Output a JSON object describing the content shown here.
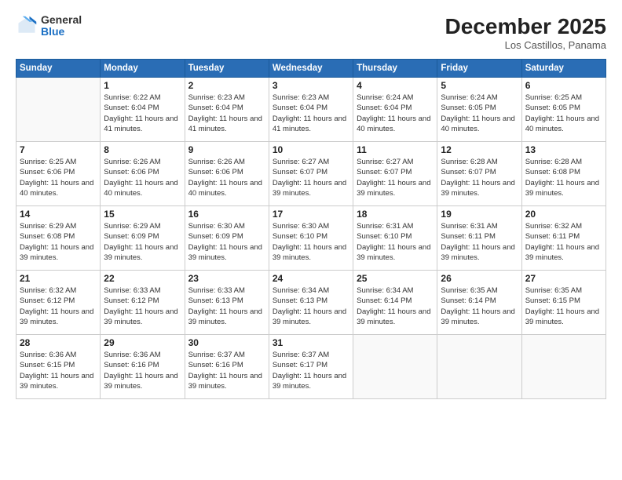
{
  "header": {
    "logo": {
      "general": "General",
      "blue": "Blue"
    },
    "title": "December 2025",
    "location": "Los Castillos, Panama"
  },
  "days_of_week": [
    "Sunday",
    "Monday",
    "Tuesday",
    "Wednesday",
    "Thursday",
    "Friday",
    "Saturday"
  ],
  "weeks": [
    [
      {
        "day": "",
        "sunrise": "",
        "sunset": "",
        "daylight": ""
      },
      {
        "day": "1",
        "sunrise": "Sunrise: 6:22 AM",
        "sunset": "Sunset: 6:04 PM",
        "daylight": "Daylight: 11 hours and 41 minutes."
      },
      {
        "day": "2",
        "sunrise": "Sunrise: 6:23 AM",
        "sunset": "Sunset: 6:04 PM",
        "daylight": "Daylight: 11 hours and 41 minutes."
      },
      {
        "day": "3",
        "sunrise": "Sunrise: 6:23 AM",
        "sunset": "Sunset: 6:04 PM",
        "daylight": "Daylight: 11 hours and 41 minutes."
      },
      {
        "day": "4",
        "sunrise": "Sunrise: 6:24 AM",
        "sunset": "Sunset: 6:04 PM",
        "daylight": "Daylight: 11 hours and 40 minutes."
      },
      {
        "day": "5",
        "sunrise": "Sunrise: 6:24 AM",
        "sunset": "Sunset: 6:05 PM",
        "daylight": "Daylight: 11 hours and 40 minutes."
      },
      {
        "day": "6",
        "sunrise": "Sunrise: 6:25 AM",
        "sunset": "Sunset: 6:05 PM",
        "daylight": "Daylight: 11 hours and 40 minutes."
      }
    ],
    [
      {
        "day": "7",
        "sunrise": "Sunrise: 6:25 AM",
        "sunset": "Sunset: 6:06 PM",
        "daylight": "Daylight: 11 hours and 40 minutes."
      },
      {
        "day": "8",
        "sunrise": "Sunrise: 6:26 AM",
        "sunset": "Sunset: 6:06 PM",
        "daylight": "Daylight: 11 hours and 40 minutes."
      },
      {
        "day": "9",
        "sunrise": "Sunrise: 6:26 AM",
        "sunset": "Sunset: 6:06 PM",
        "daylight": "Daylight: 11 hours and 40 minutes."
      },
      {
        "day": "10",
        "sunrise": "Sunrise: 6:27 AM",
        "sunset": "Sunset: 6:07 PM",
        "daylight": "Daylight: 11 hours and 39 minutes."
      },
      {
        "day": "11",
        "sunrise": "Sunrise: 6:27 AM",
        "sunset": "Sunset: 6:07 PM",
        "daylight": "Daylight: 11 hours and 39 minutes."
      },
      {
        "day": "12",
        "sunrise": "Sunrise: 6:28 AM",
        "sunset": "Sunset: 6:07 PM",
        "daylight": "Daylight: 11 hours and 39 minutes."
      },
      {
        "day": "13",
        "sunrise": "Sunrise: 6:28 AM",
        "sunset": "Sunset: 6:08 PM",
        "daylight": "Daylight: 11 hours and 39 minutes."
      }
    ],
    [
      {
        "day": "14",
        "sunrise": "Sunrise: 6:29 AM",
        "sunset": "Sunset: 6:08 PM",
        "daylight": "Daylight: 11 hours and 39 minutes."
      },
      {
        "day": "15",
        "sunrise": "Sunrise: 6:29 AM",
        "sunset": "Sunset: 6:09 PM",
        "daylight": "Daylight: 11 hours and 39 minutes."
      },
      {
        "day": "16",
        "sunrise": "Sunrise: 6:30 AM",
        "sunset": "Sunset: 6:09 PM",
        "daylight": "Daylight: 11 hours and 39 minutes."
      },
      {
        "day": "17",
        "sunrise": "Sunrise: 6:30 AM",
        "sunset": "Sunset: 6:10 PM",
        "daylight": "Daylight: 11 hours and 39 minutes."
      },
      {
        "day": "18",
        "sunrise": "Sunrise: 6:31 AM",
        "sunset": "Sunset: 6:10 PM",
        "daylight": "Daylight: 11 hours and 39 minutes."
      },
      {
        "day": "19",
        "sunrise": "Sunrise: 6:31 AM",
        "sunset": "Sunset: 6:11 PM",
        "daylight": "Daylight: 11 hours and 39 minutes."
      },
      {
        "day": "20",
        "sunrise": "Sunrise: 6:32 AM",
        "sunset": "Sunset: 6:11 PM",
        "daylight": "Daylight: 11 hours and 39 minutes."
      }
    ],
    [
      {
        "day": "21",
        "sunrise": "Sunrise: 6:32 AM",
        "sunset": "Sunset: 6:12 PM",
        "daylight": "Daylight: 11 hours and 39 minutes."
      },
      {
        "day": "22",
        "sunrise": "Sunrise: 6:33 AM",
        "sunset": "Sunset: 6:12 PM",
        "daylight": "Daylight: 11 hours and 39 minutes."
      },
      {
        "day": "23",
        "sunrise": "Sunrise: 6:33 AM",
        "sunset": "Sunset: 6:13 PM",
        "daylight": "Daylight: 11 hours and 39 minutes."
      },
      {
        "day": "24",
        "sunrise": "Sunrise: 6:34 AM",
        "sunset": "Sunset: 6:13 PM",
        "daylight": "Daylight: 11 hours and 39 minutes."
      },
      {
        "day": "25",
        "sunrise": "Sunrise: 6:34 AM",
        "sunset": "Sunset: 6:14 PM",
        "daylight": "Daylight: 11 hours and 39 minutes."
      },
      {
        "day": "26",
        "sunrise": "Sunrise: 6:35 AM",
        "sunset": "Sunset: 6:14 PM",
        "daylight": "Daylight: 11 hours and 39 minutes."
      },
      {
        "day": "27",
        "sunrise": "Sunrise: 6:35 AM",
        "sunset": "Sunset: 6:15 PM",
        "daylight": "Daylight: 11 hours and 39 minutes."
      }
    ],
    [
      {
        "day": "28",
        "sunrise": "Sunrise: 6:36 AM",
        "sunset": "Sunset: 6:15 PM",
        "daylight": "Daylight: 11 hours and 39 minutes."
      },
      {
        "day": "29",
        "sunrise": "Sunrise: 6:36 AM",
        "sunset": "Sunset: 6:16 PM",
        "daylight": "Daylight: 11 hours and 39 minutes."
      },
      {
        "day": "30",
        "sunrise": "Sunrise: 6:37 AM",
        "sunset": "Sunset: 6:16 PM",
        "daylight": "Daylight: 11 hours and 39 minutes."
      },
      {
        "day": "31",
        "sunrise": "Sunrise: 6:37 AM",
        "sunset": "Sunset: 6:17 PM",
        "daylight": "Daylight: 11 hours and 39 minutes."
      },
      {
        "day": "",
        "sunrise": "",
        "sunset": "",
        "daylight": ""
      },
      {
        "day": "",
        "sunrise": "",
        "sunset": "",
        "daylight": ""
      },
      {
        "day": "",
        "sunrise": "",
        "sunset": "",
        "daylight": ""
      }
    ]
  ]
}
